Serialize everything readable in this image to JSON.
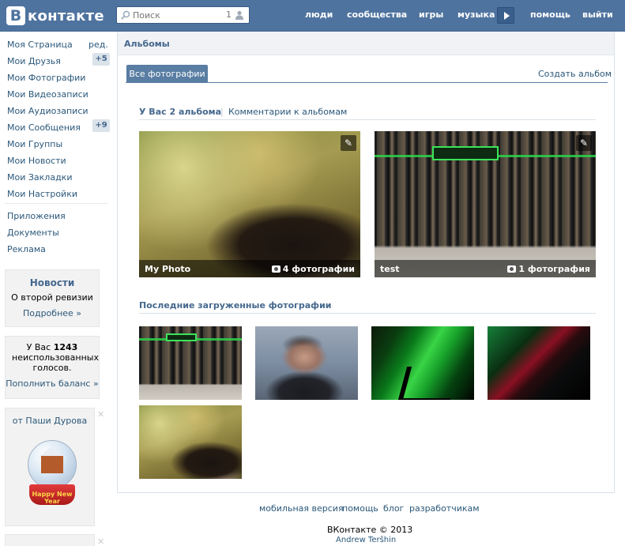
{
  "header": {
    "logo_letter": "В",
    "logo_text": "контакте",
    "search_placeholder": "Поиск",
    "search_count": "1",
    "nav": [
      "люди",
      "сообщества",
      "игры",
      "музыка",
      "помощь",
      "выйти"
    ]
  },
  "sidebar": {
    "edit_label": "ред.",
    "items": [
      {
        "label": "Моя Страница"
      },
      {
        "label": "Мои Друзья",
        "badge": "+5"
      },
      {
        "label": "Мои Фотографии"
      },
      {
        "label": "Мои Видеозаписи"
      },
      {
        "label": "Мои Аудиозаписи"
      },
      {
        "label": "Мои Сообщения",
        "badge": "+9"
      },
      {
        "label": "Мои Группы"
      },
      {
        "label": "Мои Новости"
      },
      {
        "label": "Мои Закладки"
      },
      {
        "label": "Мои Настройки"
      }
    ],
    "extra": [
      "Приложения",
      "Документы",
      "Реклама"
    ],
    "news_box": {
      "title": "Новости",
      "text": "О второй ревизии",
      "link": "Подробнее »"
    },
    "votes_box": {
      "text_before": "У Вас",
      "count": "1243",
      "text_after": "неиспользованных голосов.",
      "link": "Пополнить баланс »"
    },
    "gift_box": {
      "title": "от Паши Дурова",
      "gift_text": "Happy New Year"
    }
  },
  "main": {
    "title": "Альбомы",
    "tab_active": "Все фотографии",
    "create_album": "Создать альбом",
    "albums_summary": "У Вас 2 альбома",
    "separator": "|",
    "comments_link": "Комментарии к альбомам",
    "albums": [
      {
        "name": "My Photo",
        "count": "4 фотографии",
        "image": "boy-closeup"
      },
      {
        "name": "test",
        "count": "1 фотография",
        "image": "shop-front"
      }
    ],
    "recent_title": "Последние загруженные фотографии",
    "recent": [
      "shop-front",
      "portrait",
      "green-abstract",
      "dark-abstract",
      "boy-closeup"
    ]
  },
  "footer": {
    "links": [
      "мобильная версия",
      "помощь",
      "блог",
      "разработчикам"
    ],
    "copyright": "ВКонтакте © 2013",
    "author": "Andrew Teršhin"
  },
  "colors": {
    "header_bg": "#4f739f",
    "link": "#2b587a",
    "accent": "#597da3",
    "badge_bg": "#dae2ea"
  }
}
